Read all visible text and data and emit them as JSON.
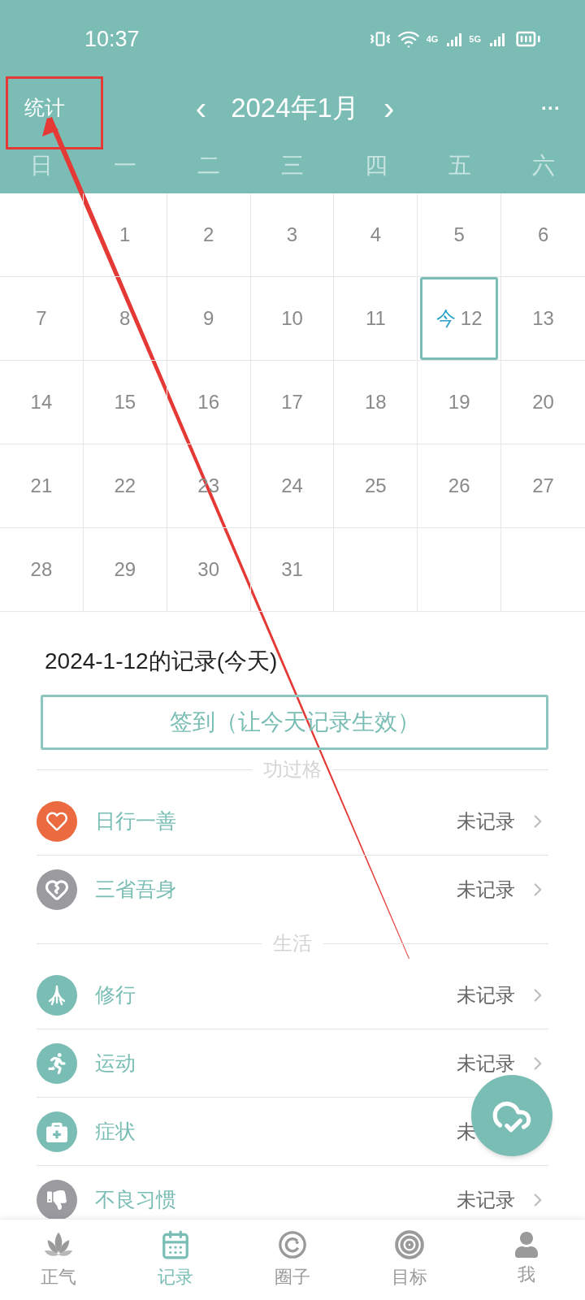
{
  "status_bar": {
    "time": "10:37",
    "network_1": "4G",
    "network_2": "5G"
  },
  "header": {
    "left_action": "统计",
    "prev": "‹",
    "title": "2024年1月",
    "next": "›",
    "more": "···"
  },
  "weekdays": [
    "日",
    "一",
    "二",
    "三",
    "四",
    "五",
    "六"
  ],
  "calendar": {
    "weeks": [
      {
        "days": [
          {
            "day": "1",
            "selected": false
          },
          {
            "day": "2",
            "selected": false
          },
          {
            "day": "3",
            "selected": false
          },
          {
            "day": "4",
            "selected": false
          },
          {
            "day": "5",
            "selected": false
          },
          {
            "day": "6",
            "selected": false
          }
        ]
      },
      {
        "days": [
          {
            "day": "7",
            "selected": false
          },
          {
            "day": "8",
            "selected": false
          },
          {
            "day": "9",
            "selected": false
          },
          {
            "day": "10",
            "selected": false
          },
          {
            "day": "11",
            "selected": false
          },
          {
            "day": "12",
            "selected": true,
            "badge": "今"
          },
          {
            "day": "13",
            "selected": false
          }
        ]
      },
      {
        "days": [
          {
            "day": "14",
            "selected": false
          },
          {
            "day": "15",
            "selected": false
          },
          {
            "day": "16",
            "selected": false
          },
          {
            "day": "17",
            "selected": false
          },
          {
            "day": "18",
            "selected": false
          },
          {
            "day": "19",
            "selected": false
          },
          {
            "day": "20",
            "selected": false
          }
        ]
      },
      {
        "days": [
          {
            "day": "21",
            "selected": false
          },
          {
            "day": "22",
            "selected": false
          },
          {
            "day": "23",
            "selected": false
          },
          {
            "day": "24",
            "selected": false
          },
          {
            "day": "25",
            "selected": false
          },
          {
            "day": "26",
            "selected": false
          },
          {
            "day": "27",
            "selected": false
          }
        ]
      },
      {
        "days": [
          {
            "day": "28",
            "selected": false
          },
          {
            "day": "29",
            "selected": false
          },
          {
            "day": "30",
            "selected": false
          },
          {
            "day": "31",
            "selected": false
          }
        ]
      }
    ]
  },
  "record": {
    "title": "2024-1-12的记录(今天)",
    "checkin_button": "签到（让今天记录生效）"
  },
  "sections": [
    {
      "title": "功过格",
      "items": [
        {
          "label": "日行一善",
          "status": "未记录",
          "kind": "heart",
          "color": "#ec6a3f",
          "chevron": true
        },
        {
          "label": "三省吾身",
          "status": "未记录",
          "kind": "broken-heart",
          "color": "#9b9b9f",
          "chevron": true
        }
      ]
    },
    {
      "title": "生活",
      "items": [
        {
          "label": "修行",
          "status": "未记录",
          "kind": "roots",
          "color": "#79bdb4",
          "chevron": true
        },
        {
          "label": "运动",
          "status": "未记录",
          "kind": "runner",
          "color": "#79bdb4",
          "chevron": true
        },
        {
          "label": "症状",
          "status": "未",
          "kind": "medkit",
          "color": "#79bdb4",
          "chevron": false
        },
        {
          "label": "不良习惯",
          "status": "未记录",
          "kind": "thumbs-down",
          "color": "#9b9b9f",
          "chevron": true
        }
      ]
    }
  ],
  "bottom_nav": [
    {
      "label": "正气",
      "kind": "lotus",
      "selected": false
    },
    {
      "label": "记录",
      "kind": "calendar",
      "selected": true
    },
    {
      "label": "圈子",
      "kind": "circle",
      "selected": false
    },
    {
      "label": "目标",
      "kind": "target",
      "selected": false
    },
    {
      "label": "我",
      "kind": "user",
      "selected": false
    }
  ]
}
